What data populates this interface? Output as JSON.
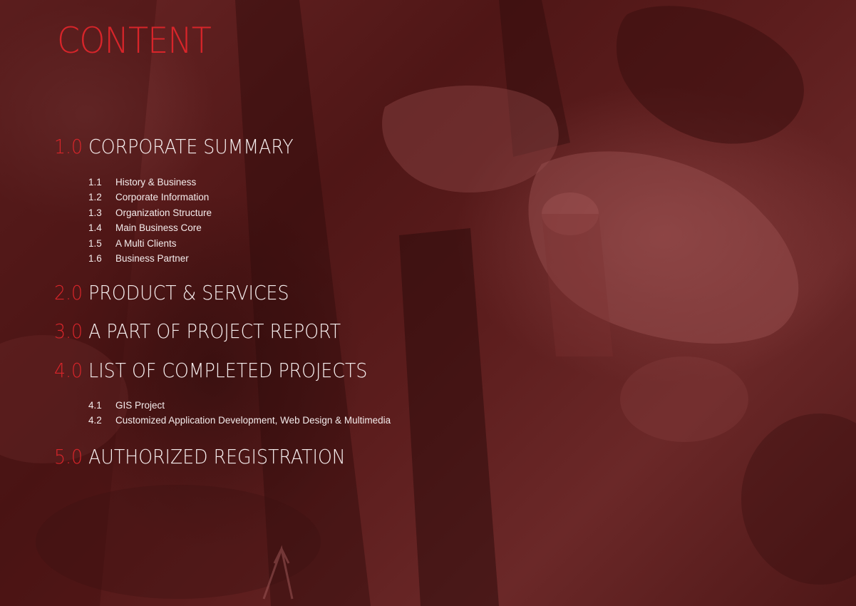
{
  "title": "CONTENT",
  "colors": {
    "accent": "#d8252a",
    "background": "#5a1b1b",
    "text": "#f6eeee"
  },
  "sections": [
    {
      "number": "1.0",
      "label": "CORPORATE SUMMARY",
      "subitems": [
        {
          "number": "1.1",
          "label": "History & Business"
        },
        {
          "number": "1.2",
          "label": "Corporate Information"
        },
        {
          "number": "1.3",
          "label": "Organization Structure"
        },
        {
          "number": "1.4",
          "label": "Main Business Core"
        },
        {
          "number": "1.5",
          "label": "A Multi Clients"
        },
        {
          "number": "1.6",
          "label": "Business Partner"
        }
      ]
    },
    {
      "number": "2.0",
      "label": "PRODUCT & SERVICES",
      "subitems": []
    },
    {
      "number": "3.0",
      "label": "A PART OF PROJECT REPORT",
      "subitems": []
    },
    {
      "number": "4.0",
      "label": "LIST OF COMPLETED PROJECTS",
      "subitems": [
        {
          "number": "4.1",
          "label": "GIS Project"
        },
        {
          "number": "4.2",
          "label": "Customized Application Development, Web Design & Multimedia"
        }
      ]
    },
    {
      "number": "5.0",
      "label": "AUTHORIZED REGISTRATION",
      "subitems": []
    }
  ]
}
